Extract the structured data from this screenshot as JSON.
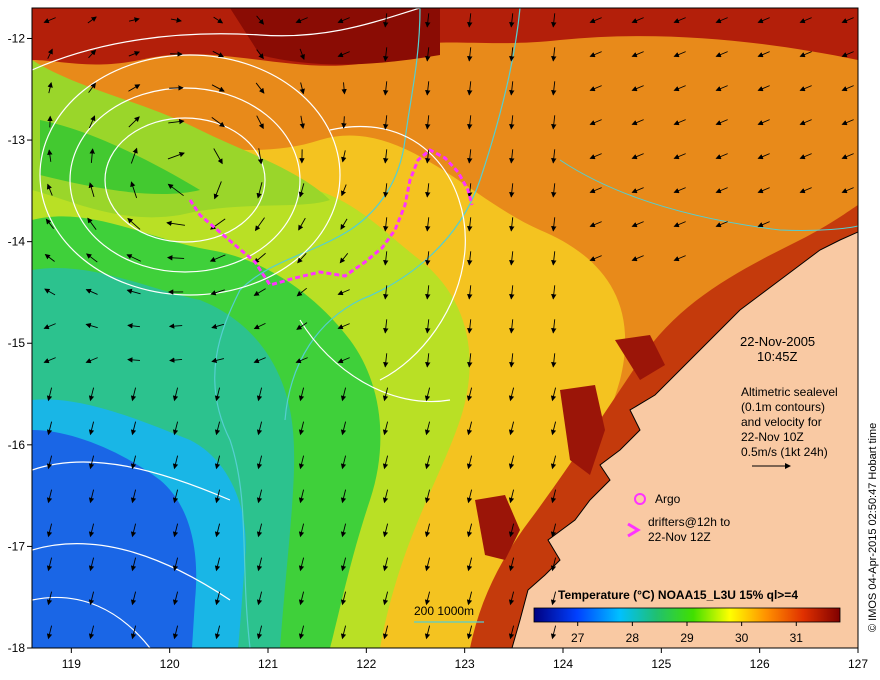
{
  "map": {
    "x_ticks": [
      "119",
      "120",
      "121",
      "122",
      "123",
      "124",
      "125",
      "126",
      "127"
    ],
    "y_ticks": [
      "-12",
      "-13",
      "-14",
      "-15",
      "-16",
      "-17",
      "-18"
    ],
    "x_range": [
      118.6,
      127.0
    ],
    "y_range": [
      -18.0,
      -11.7
    ]
  },
  "info": {
    "date": "22-Nov-2005",
    "time": "10:45Z",
    "alt_lines": [
      "Altimetric sealevel",
      "(0.1m contours)",
      "and velocity for",
      "22-Nov 10Z",
      "0.5m/s (1kt 24h)"
    ]
  },
  "legend": {
    "argo_label": "Argo",
    "drifters_line1": "drifters@12h to",
    "drifters_line2": "22-Nov 12Z"
  },
  "depth_legend": "200  1000m",
  "colorbar": {
    "title": "Temperature (°C) NOAA15_L3U 15% ql>=4",
    "ticks": [
      "27",
      "28",
      "29",
      "30",
      "31"
    ],
    "tick_values": [
      27,
      28,
      29,
      30,
      31
    ],
    "range": [
      26.2,
      31.8
    ]
  },
  "credit": "© IMOS 04-Apr-2015 02:50:47 Hobart time",
  "colors": {
    "land": "#f9c9a3",
    "drifter": "#ff33ff",
    "contour": "#ffffff",
    "isobath": "#55cfd1"
  }
}
